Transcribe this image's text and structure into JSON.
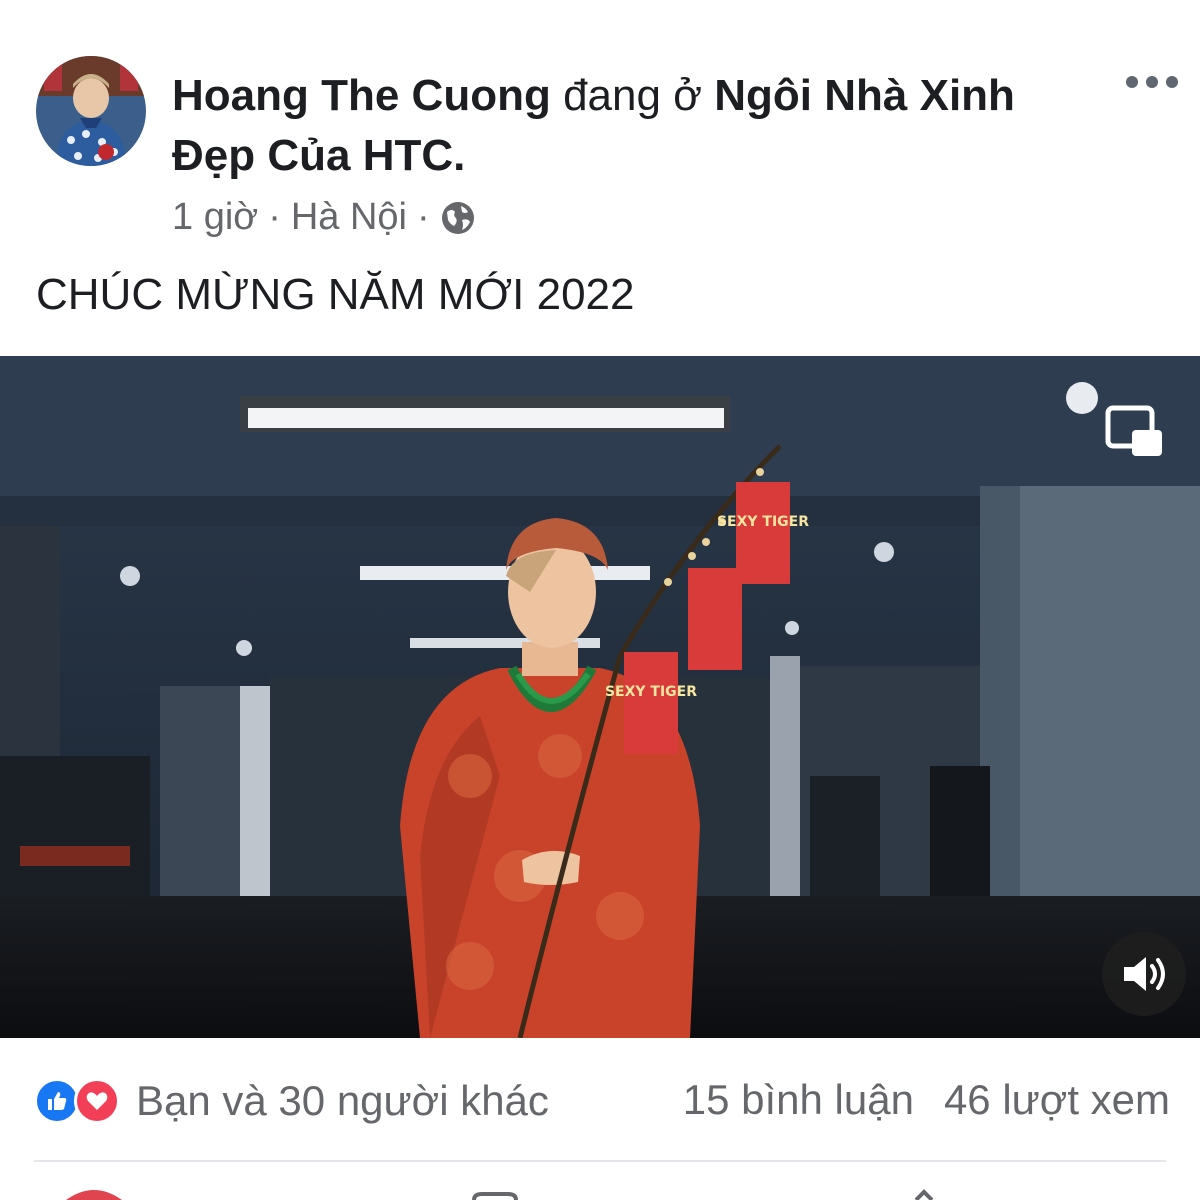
{
  "post": {
    "author_name": "Hoang The Cuong",
    "checkin_verb": "đang ở",
    "place_name": "Ngôi Nhà Xinh Đẹp Của HTC.",
    "time": "1 giờ",
    "separator": "·",
    "location": "Hà Nội",
    "caption": "CHÚC MỪNG NĂM MỚI 2022"
  },
  "video": {
    "lantern_text": "SEXY TIGER"
  },
  "footer": {
    "reactions_text": "Bạn và 30 người khác",
    "comments_text": "15 bình luận",
    "views_text": "46 lượt xem"
  },
  "colors": {
    "brand_blue": "#1877f2",
    "love_red": "#f33e58",
    "secondary_text": "#65676b"
  },
  "icons": {
    "more": "more-dots-icon",
    "privacy": "globe-icon",
    "pip": "picture-in-picture-icon",
    "sound": "speaker-icon",
    "like": "thumbs-up-icon",
    "love": "heart-icon"
  }
}
